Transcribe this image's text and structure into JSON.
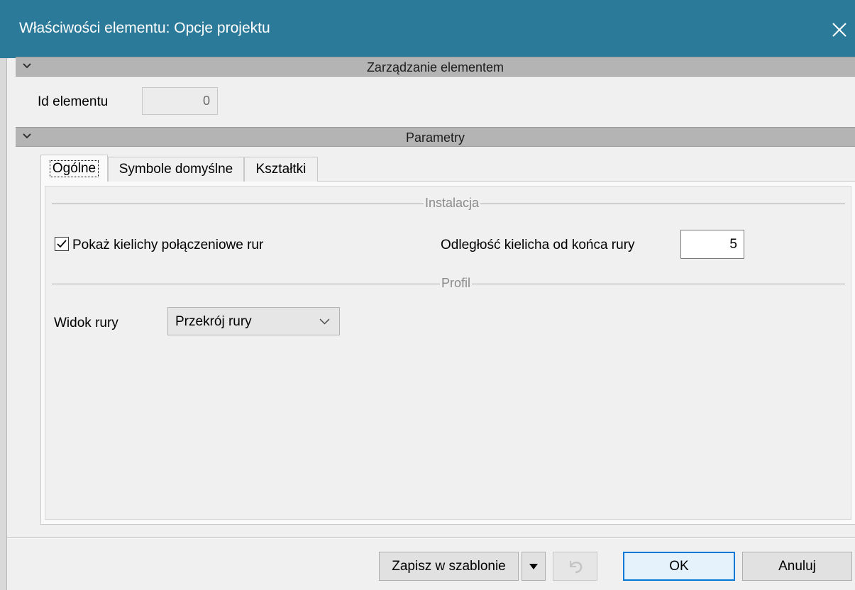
{
  "window": {
    "title": "Właściwości elementu: Opcje projektu",
    "accent_color": "#2b7a9a",
    "close_icon": "close-icon"
  },
  "sections": {
    "element_management": {
      "label": "Zarządzanie elementem",
      "expanded": true,
      "icon": "chevron-down-icon"
    },
    "parameters": {
      "label": "Parametry",
      "expanded": true,
      "icon": "chevron-down-icon"
    }
  },
  "element_id": {
    "label": "Id elementu",
    "value": "0",
    "readonly": true
  },
  "tabs": [
    {
      "label": "Ogólne",
      "active": true
    },
    {
      "label": "Symbole domyślne",
      "active": false
    },
    {
      "label": "Kształtki",
      "active": false
    }
  ],
  "general_tab": {
    "installation": {
      "group_label": "Instalacja",
      "show_sockets": {
        "label": "Pokaż kielichy połączeniowe rur",
        "checked": true
      },
      "socket_distance": {
        "label": "Odległość kielicha od końca rury",
        "value": "5"
      }
    },
    "profile": {
      "group_label": "Profil",
      "pipe_view": {
        "label": "Widok rury",
        "selected": "Przekrój rury"
      }
    }
  },
  "footer": {
    "save_template_label": "Zapisz w szablonie",
    "save_dropdown_icon": "caret-down-icon",
    "restore_icon": "undo-icon",
    "restore_enabled": false,
    "ok_label": "OK",
    "cancel_label": "Anuluj",
    "ok_border_color": "#0078d7"
  }
}
